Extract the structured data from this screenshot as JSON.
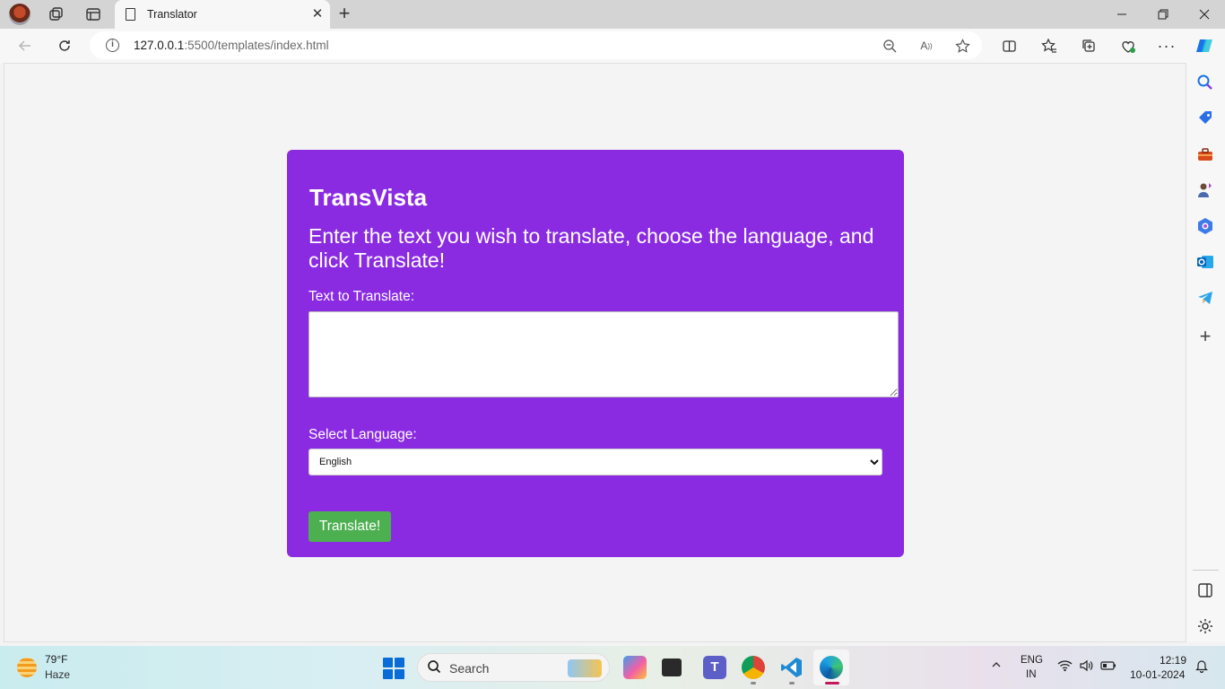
{
  "browser": {
    "tab": {
      "title": "Translator"
    },
    "address": {
      "host": "127.0.0.1",
      "path": ":5500/templates/index.html"
    },
    "sidebar_icons": [
      "search-icon",
      "shopping-tag-icon",
      "toolbox-icon",
      "games-icon",
      "copilot-icon",
      "outlook-icon",
      "telegram-icon",
      "add-icon",
      "split-pane-icon",
      "settings-icon"
    ]
  },
  "page": {
    "title": "TransVista",
    "intro": "Enter the text you wish to translate, choose the language, and click Translate!",
    "text_label": "Text to Translate:",
    "text_value": "",
    "language_label": "Select Language:",
    "language_selected": "English",
    "translate_button": "Translate!",
    "accent_color": "#8a2be2",
    "button_color": "#4caf50"
  },
  "taskbar": {
    "weather": {
      "temp": "79°F",
      "condition": "Haze"
    },
    "search_label": "Search",
    "language": {
      "top": "ENG",
      "bottom": "IN"
    },
    "clock": {
      "time": "12:19",
      "date": "10-01-2024"
    }
  }
}
